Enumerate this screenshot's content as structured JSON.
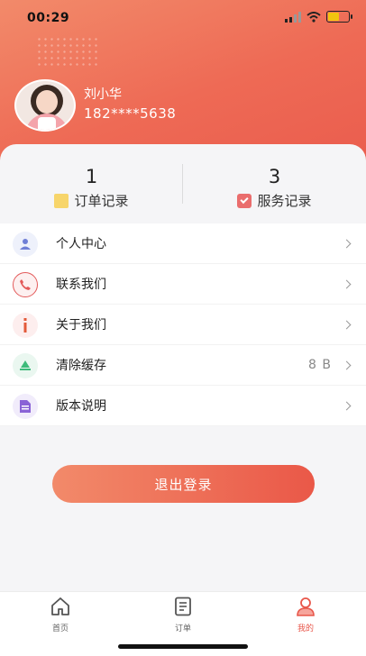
{
  "status_bar": {
    "time": "00:29"
  },
  "profile": {
    "name": "刘小华",
    "phone": "182****5638"
  },
  "stats": [
    {
      "count": "1",
      "label": "订单记录",
      "icon": "order-record-icon"
    },
    {
      "count": "3",
      "label": "服务记录",
      "icon": "service-record-icon"
    }
  ],
  "menu": [
    {
      "label": "个人中心",
      "value": "",
      "icon": "person-center-icon"
    },
    {
      "label": "联系我们",
      "value": "",
      "icon": "phone-icon"
    },
    {
      "label": "关于我们",
      "value": "",
      "icon": "info-icon"
    },
    {
      "label": "清除缓存",
      "value": "8 B",
      "icon": "broom-icon"
    },
    {
      "label": "版本说明",
      "value": "",
      "icon": "document-icon"
    }
  ],
  "logout_label": "退出登录",
  "tabbar": [
    {
      "label": "首页",
      "icon": "home-icon",
      "active": false
    },
    {
      "label": "订单",
      "icon": "order-list-icon",
      "active": false
    },
    {
      "label": "我的",
      "icon": "profile-icon",
      "active": true
    }
  ],
  "colors": {
    "accent": "#e8564a",
    "accent_light": "#f28a6a",
    "card_bg": "#f5f5f7"
  }
}
